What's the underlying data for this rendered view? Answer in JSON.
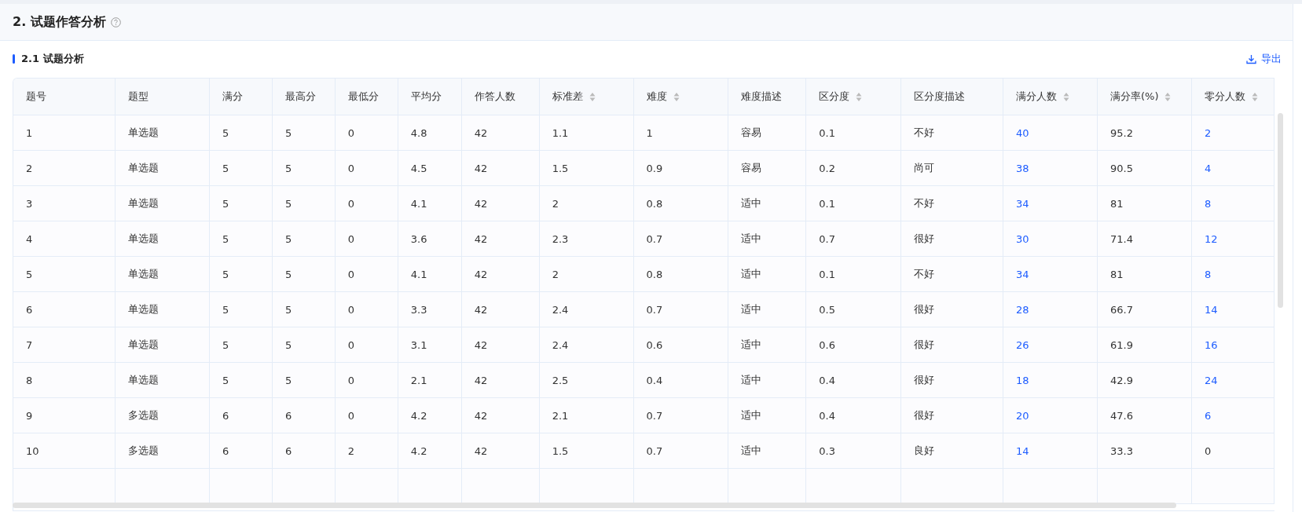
{
  "section": {
    "title": "2. 试题作答分析"
  },
  "subsection": {
    "title": "2.1 试题分析",
    "export_label": "导出"
  },
  "table": {
    "columns": [
      {
        "label": "题号",
        "sortable": false
      },
      {
        "label": "题型",
        "sortable": false
      },
      {
        "label": "满分",
        "sortable": false
      },
      {
        "label": "最高分",
        "sortable": false
      },
      {
        "label": "最低分",
        "sortable": false
      },
      {
        "label": "平均分",
        "sortable": false
      },
      {
        "label": "作答人数",
        "sortable": false
      },
      {
        "label": "标准差",
        "sortable": true
      },
      {
        "label": "难度",
        "sortable": true
      },
      {
        "label": "难度描述",
        "sortable": false
      },
      {
        "label": "区分度",
        "sortable": true
      },
      {
        "label": "区分度描述",
        "sortable": false
      },
      {
        "label": "满分人数",
        "sortable": true
      },
      {
        "label": "满分率(%)",
        "sortable": true
      },
      {
        "label": "零分人数",
        "sortable": true
      }
    ],
    "rows": [
      {
        "cells": [
          "1",
          "单选题",
          "5",
          "5",
          "0",
          "4.8",
          "42",
          "1.1",
          "1",
          "容易",
          "0.1",
          "不好",
          {
            "text": "40",
            "link": true
          },
          "95.2",
          {
            "text": "2",
            "link": true
          }
        ]
      },
      {
        "cells": [
          "2",
          "单选题",
          "5",
          "5",
          "0",
          "4.5",
          "42",
          "1.5",
          "0.9",
          "容易",
          "0.2",
          "尚可",
          {
            "text": "38",
            "link": true
          },
          "90.5",
          {
            "text": "4",
            "link": true
          }
        ]
      },
      {
        "cells": [
          "3",
          "单选题",
          "5",
          "5",
          "0",
          "4.1",
          "42",
          "2",
          "0.8",
          "适中",
          "0.1",
          "不好",
          {
            "text": "34",
            "link": true
          },
          "81",
          {
            "text": "8",
            "link": true
          }
        ]
      },
      {
        "cells": [
          "4",
          "单选题",
          "5",
          "5",
          "0",
          "3.6",
          "42",
          "2.3",
          "0.7",
          "适中",
          "0.7",
          "很好",
          {
            "text": "30",
            "link": true
          },
          "71.4",
          {
            "text": "12",
            "link": true
          }
        ]
      },
      {
        "cells": [
          "5",
          "单选题",
          "5",
          "5",
          "0",
          "4.1",
          "42",
          "2",
          "0.8",
          "适中",
          "0.1",
          "不好",
          {
            "text": "34",
            "link": true
          },
          "81",
          {
            "text": "8",
            "link": true
          }
        ]
      },
      {
        "cells": [
          "6",
          "单选题",
          "5",
          "5",
          "0",
          "3.3",
          "42",
          "2.4",
          "0.7",
          "适中",
          "0.5",
          "很好",
          {
            "text": "28",
            "link": true
          },
          "66.7",
          {
            "text": "14",
            "link": true
          }
        ]
      },
      {
        "cells": [
          "7",
          "单选题",
          "5",
          "5",
          "0",
          "3.1",
          "42",
          "2.4",
          "0.6",
          "适中",
          "0.6",
          "很好",
          {
            "text": "26",
            "link": true
          },
          "61.9",
          {
            "text": "16",
            "link": true
          }
        ]
      },
      {
        "cells": [
          "8",
          "单选题",
          "5",
          "5",
          "0",
          "2.1",
          "42",
          "2.5",
          "0.4",
          "适中",
          "0.4",
          "很好",
          {
            "text": "18",
            "link": true
          },
          "42.9",
          {
            "text": "24",
            "link": true
          }
        ]
      },
      {
        "cells": [
          "9",
          "多选题",
          "6",
          "6",
          "0",
          "4.2",
          "42",
          "2.1",
          "0.7",
          "适中",
          "0.4",
          "很好",
          {
            "text": "20",
            "link": true
          },
          "47.6",
          {
            "text": "6",
            "link": true
          }
        ]
      },
      {
        "cells": [
          "10",
          "多选题",
          "6",
          "6",
          "2",
          "4.2",
          "42",
          "1.5",
          "0.7",
          "适中",
          "0.3",
          "良好",
          {
            "text": "14",
            "link": true
          },
          "33.3",
          {
            "text": "0",
            "link": false
          }
        ]
      }
    ]
  }
}
